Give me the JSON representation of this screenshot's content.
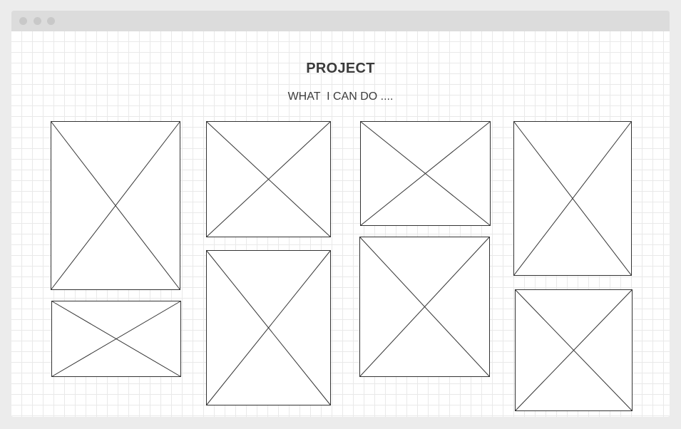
{
  "page": {
    "title": "PROJECT",
    "subtitle": "WHAT  I CAN DO ...."
  },
  "window": {
    "buttons": [
      "close",
      "minimize",
      "maximize"
    ]
  },
  "gallery": {
    "placeholder_count": 8,
    "placeholder_kind": "image-placeholder"
  },
  "colors": {
    "background": "#ececec",
    "titlebar": "#dcdcdc",
    "grid": "#e9e9e9",
    "stroke": "#333333",
    "text": "#3b3b3b"
  }
}
